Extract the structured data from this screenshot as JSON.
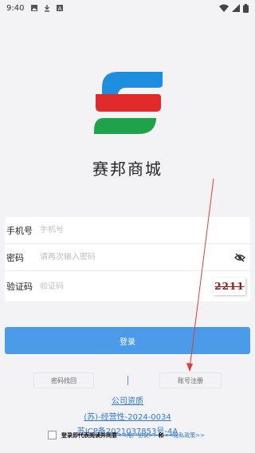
{
  "status_bar": {
    "time": "9:40",
    "icons_left": [
      "image-icon",
      "download-icon",
      "a-icon"
    ],
    "icons_right": [
      "wifi-icon",
      "signal-icon",
      "battery-icon"
    ]
  },
  "app": {
    "title": "赛邦商城",
    "logo_colors": [
      "#1f8ee0",
      "#e02a2a",
      "#1ea34a"
    ]
  },
  "form": {
    "phone": {
      "label": "手机号",
      "placeholder": "手机号"
    },
    "password": {
      "label": "密码",
      "placeholder": "请再次输入密码"
    },
    "code": {
      "label": "验证码",
      "placeholder": "验证码",
      "captcha_text": "2211"
    }
  },
  "login_button": "登录",
  "links": {
    "forgot": "密码找回",
    "register": "账号注册"
  },
  "footer": {
    "qualification": "公司资质",
    "license": "(苏)-经营性-2024-0034",
    "icp": "苏ICP备2021037853号-4A",
    "agree_prefix": "登录即代表阅读并同意",
    "user_agreement": "<<用户协议>>",
    "and": "和",
    "privacy_policy": "<<隐私政策>>"
  },
  "colors": {
    "accent": "#4c9be8",
    "link": "#2f78d4",
    "annotation_arrow": "#d9403a"
  }
}
